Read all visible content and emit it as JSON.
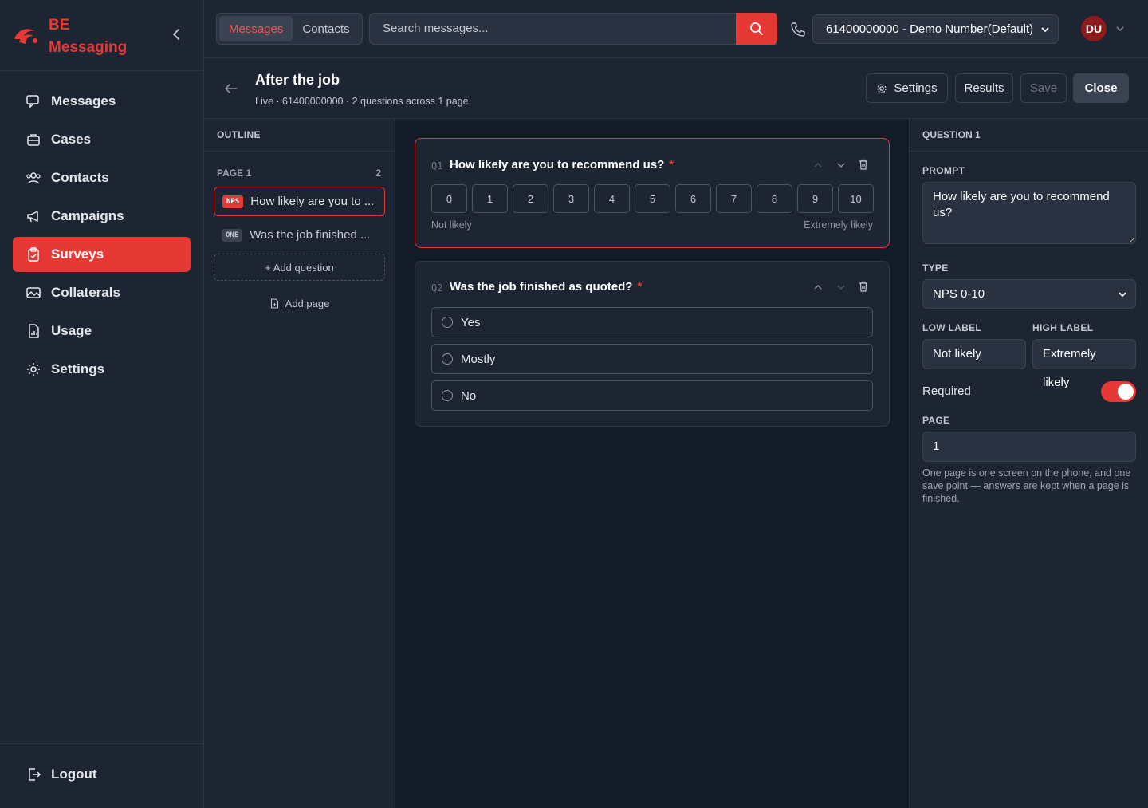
{
  "brand": {
    "line1": "BE",
    "line2": "Messaging"
  },
  "nav": {
    "items": [
      {
        "label": "Messages",
        "icon": "message-icon"
      },
      {
        "label": "Cases",
        "icon": "briefcase-icon"
      },
      {
        "label": "Contacts",
        "icon": "users-icon"
      },
      {
        "label": "Campaigns",
        "icon": "megaphone-icon"
      },
      {
        "label": "Surveys",
        "icon": "clipboard-icon",
        "active": true
      },
      {
        "label": "Collaterals",
        "icon": "image-icon"
      },
      {
        "label": "Usage",
        "icon": "file-chart-icon"
      },
      {
        "label": "Settings",
        "icon": "gear-icon"
      }
    ],
    "logout": "Logout"
  },
  "topbar": {
    "segments": [
      "Messages",
      "Contacts"
    ],
    "search_placeholder": "Search messages...",
    "number": "61400000000 - Demo Number(Default)",
    "avatar": "DU"
  },
  "header": {
    "title": "After the job",
    "meta": "Live · 61400000000 · 2 questions across 1 page",
    "buttons": {
      "settings": "Settings",
      "results": "Results",
      "save": "Save",
      "close": "Close"
    }
  },
  "outline": {
    "heading": "OUTLINE",
    "page_label": "PAGE 1",
    "page_count": "2",
    "items": [
      {
        "badge": "NPS",
        "label": "How likely are you to ..."
      },
      {
        "badge": "ONE",
        "label": "Was the job finished ..."
      }
    ],
    "add_question": "+ Add question",
    "add_page": "Add page"
  },
  "questions": {
    "q1": {
      "num": "Q1",
      "title": "How likely are you to recommend us?",
      "required_mark": "*",
      "scale": [
        "0",
        "1",
        "2",
        "3",
        "4",
        "5",
        "6",
        "7",
        "8",
        "9",
        "10"
      ],
      "low": "Not likely",
      "high": "Extremely likely"
    },
    "q2": {
      "num": "Q2",
      "title": "Was the job finished as quoted?",
      "required_mark": "*",
      "options": [
        "Yes",
        "Mostly",
        "No"
      ]
    }
  },
  "inspector": {
    "heading": "QUESTION 1",
    "prompt_label": "PROMPT",
    "prompt_value": "How likely are you to recommend us?",
    "type_label": "TYPE",
    "type_value": "NPS 0-10",
    "low_label": "LOW LABEL",
    "high_label": "HIGH LABEL",
    "low_value": "Not likely",
    "high_value": "Extremely likely",
    "required_label": "Required",
    "required": true,
    "page_label": "PAGE",
    "page_value": "1",
    "help": "One page is one screen on the phone, and one save point — answers are kept when a page is finished."
  },
  "colors": {
    "accent": "#e53935",
    "bg": "#131a28",
    "panel": "#1e2532"
  }
}
